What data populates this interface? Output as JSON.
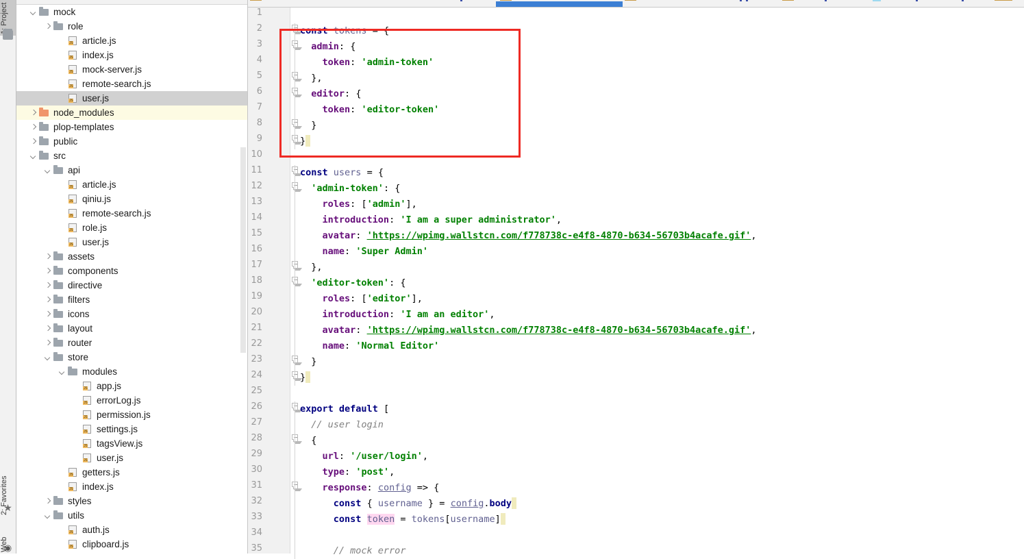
{
  "window": {
    "app": "IntelliJ IDEA / WebStorm project window"
  },
  "tool_strip": {
    "buttons": [
      {
        "label": "1: Project",
        "icon": "folder-icon",
        "active": true
      },
      {
        "label": "2: Favorites",
        "icon": "star-icon",
        "active": false
      },
      {
        "label": "Web",
        "icon": "globe-icon",
        "active": false
      }
    ]
  },
  "project_tree": {
    "items": [
      {
        "label": "mock",
        "indent": 2,
        "arrow": "open",
        "icon": "folder-icon",
        "state": "normal"
      },
      {
        "label": "role",
        "indent": 3,
        "arrow": "closed",
        "icon": "folder-icon",
        "state": "normal"
      },
      {
        "label": "article.js",
        "indent": 4,
        "arrow": "none",
        "icon": "js-file-icon",
        "state": "normal"
      },
      {
        "label": "index.js",
        "indent": 4,
        "arrow": "none",
        "icon": "js-file-icon",
        "state": "normal"
      },
      {
        "label": "mock-server.js",
        "indent": 4,
        "arrow": "none",
        "icon": "js-file-icon",
        "state": "normal"
      },
      {
        "label": "remote-search.js",
        "indent": 4,
        "arrow": "none",
        "icon": "js-file-icon",
        "state": "normal"
      },
      {
        "label": "user.js",
        "indent": 4,
        "arrow": "none",
        "icon": "js-file-icon",
        "state": "selected"
      },
      {
        "label": "node_modules",
        "indent": 2,
        "arrow": "closed",
        "icon": "folder-icon-orange",
        "state": "highlighted"
      },
      {
        "label": "plop-templates",
        "indent": 2,
        "arrow": "closed",
        "icon": "folder-icon",
        "state": "normal"
      },
      {
        "label": "public",
        "indent": 2,
        "arrow": "closed",
        "icon": "folder-icon",
        "state": "normal"
      },
      {
        "label": "src",
        "indent": 2,
        "arrow": "open",
        "icon": "folder-icon",
        "state": "normal"
      },
      {
        "label": "api",
        "indent": 3,
        "arrow": "open",
        "icon": "folder-icon",
        "state": "normal"
      },
      {
        "label": "article.js",
        "indent": 4,
        "arrow": "none",
        "icon": "js-file-icon",
        "state": "normal"
      },
      {
        "label": "qiniu.js",
        "indent": 4,
        "arrow": "none",
        "icon": "js-file-icon",
        "state": "normal"
      },
      {
        "label": "remote-search.js",
        "indent": 4,
        "arrow": "none",
        "icon": "js-file-icon",
        "state": "normal"
      },
      {
        "label": "role.js",
        "indent": 4,
        "arrow": "none",
        "icon": "js-file-icon",
        "state": "normal"
      },
      {
        "label": "user.js",
        "indent": 4,
        "arrow": "none",
        "icon": "js-file-icon",
        "state": "normal"
      },
      {
        "label": "assets",
        "indent": 3,
        "arrow": "closed",
        "icon": "folder-icon",
        "state": "normal"
      },
      {
        "label": "components",
        "indent": 3,
        "arrow": "closed",
        "icon": "folder-icon",
        "state": "normal"
      },
      {
        "label": "directive",
        "indent": 3,
        "arrow": "closed",
        "icon": "folder-icon",
        "state": "normal"
      },
      {
        "label": "filters",
        "indent": 3,
        "arrow": "closed",
        "icon": "folder-icon",
        "state": "normal"
      },
      {
        "label": "icons",
        "indent": 3,
        "arrow": "closed",
        "icon": "folder-icon",
        "state": "normal"
      },
      {
        "label": "layout",
        "indent": 3,
        "arrow": "closed",
        "icon": "folder-icon",
        "state": "normal"
      },
      {
        "label": "router",
        "indent": 3,
        "arrow": "closed",
        "icon": "folder-icon",
        "state": "normal"
      },
      {
        "label": "store",
        "indent": 3,
        "arrow": "open",
        "icon": "folder-icon",
        "state": "normal"
      },
      {
        "label": "modules",
        "indent": 4,
        "arrow": "open",
        "icon": "folder-icon",
        "state": "normal"
      },
      {
        "label": "app.js",
        "indent": 5,
        "arrow": "none",
        "icon": "js-file-icon",
        "state": "normal"
      },
      {
        "label": "errorLog.js",
        "indent": 5,
        "arrow": "none",
        "icon": "js-file-icon",
        "state": "normal"
      },
      {
        "label": "permission.js",
        "indent": 5,
        "arrow": "none",
        "icon": "js-file-icon",
        "state": "normal"
      },
      {
        "label": "settings.js",
        "indent": 5,
        "arrow": "none",
        "icon": "js-file-icon",
        "state": "normal"
      },
      {
        "label": "tagsView.js",
        "indent": 5,
        "arrow": "none",
        "icon": "js-file-icon",
        "state": "normal"
      },
      {
        "label": "user.js",
        "indent": 5,
        "arrow": "none",
        "icon": "js-file-icon",
        "state": "normal"
      },
      {
        "label": "getters.js",
        "indent": 4,
        "arrow": "none",
        "icon": "js-file-icon",
        "state": "normal"
      },
      {
        "label": "index.js",
        "indent": 4,
        "arrow": "none",
        "icon": "js-file-icon",
        "state": "normal"
      },
      {
        "label": "styles",
        "indent": 3,
        "arrow": "closed",
        "icon": "folder-icon",
        "state": "normal"
      },
      {
        "label": "utils",
        "indent": 3,
        "arrow": "open",
        "icon": "folder-icon",
        "state": "normal"
      },
      {
        "label": "auth.js",
        "indent": 4,
        "arrow": "none",
        "icon": "js-file-icon",
        "state": "normal"
      },
      {
        "label": "clipboard.js",
        "indent": 4,
        "arrow": "none",
        "icon": "js-file-icon",
        "state": "normal"
      }
    ]
  },
  "editor": {
    "first_visible_line": 1,
    "last_visible_line": 35,
    "line_numbers": [
      1,
      2,
      3,
      4,
      5,
      6,
      7,
      8,
      9,
      10,
      11,
      12,
      13,
      14,
      15,
      16,
      17,
      18,
      19,
      20,
      21,
      22,
      23,
      24,
      25,
      26,
      27,
      28,
      29,
      30,
      31,
      32,
      33,
      34,
      35
    ],
    "fold_lines": [
      2,
      3,
      5,
      6,
      8,
      9,
      11,
      12,
      17,
      18,
      23,
      24,
      26,
      28,
      31
    ],
    "annotation": {
      "type": "red-rectangle-highlight",
      "color": "#ee2a24",
      "covers_lines": "2-9",
      "content": "const tokens = { admin: { token: 'admin-token' }, editor: { token: 'editor-token' } }"
    },
    "lines": [
      {
        "n": 1,
        "text": ""
      },
      {
        "n": 2,
        "text": "const tokens = {"
      },
      {
        "n": 3,
        "text": "  admin: {"
      },
      {
        "n": 4,
        "text": "    token: 'admin-token'"
      },
      {
        "n": 5,
        "text": "  },"
      },
      {
        "n": 6,
        "text": "  editor: {"
      },
      {
        "n": 7,
        "text": "    token: 'editor-token'"
      },
      {
        "n": 8,
        "text": "  }"
      },
      {
        "n": 9,
        "text": "}"
      },
      {
        "n": 10,
        "text": ""
      },
      {
        "n": 11,
        "text": "const users = {"
      },
      {
        "n": 12,
        "text": "  'admin-token': {"
      },
      {
        "n": 13,
        "text": "    roles: ['admin'],"
      },
      {
        "n": 14,
        "text": "    introduction: 'I am a super administrator',"
      },
      {
        "n": 15,
        "text": "    avatar: 'https://wpimg.wallstcn.com/f778738c-e4f8-4870-b634-56703b4acafe.gif',"
      },
      {
        "n": 16,
        "text": "    name: 'Super Admin'"
      },
      {
        "n": 17,
        "text": "  },"
      },
      {
        "n": 18,
        "text": "  'editor-token': {"
      },
      {
        "n": 19,
        "text": "    roles: ['editor'],"
      },
      {
        "n": 20,
        "text": "    introduction: 'I am an editor',"
      },
      {
        "n": 21,
        "text": "    avatar: 'https://wpimg.wallstcn.com/f778738c-e4f8-4870-b634-56703b4acafe.gif',"
      },
      {
        "n": 22,
        "text": "    name: 'Normal Editor'"
      },
      {
        "n": 23,
        "text": "  }"
      },
      {
        "n": 24,
        "text": "}"
      },
      {
        "n": 25,
        "text": ""
      },
      {
        "n": 26,
        "text": "export default ["
      },
      {
        "n": 27,
        "text": "  // user login"
      },
      {
        "n": 28,
        "text": "  {"
      },
      {
        "n": 29,
        "text": "    url: '/user/login',"
      },
      {
        "n": 30,
        "text": "    type: 'post',"
      },
      {
        "n": 31,
        "text": "    response: config => {"
      },
      {
        "n": 32,
        "text": "      const { username } = config.body"
      },
      {
        "n": 33,
        "text": "      const token = tokens[username]"
      },
      {
        "n": 34,
        "text": ""
      },
      {
        "n": 35,
        "text": "      // mock error"
      }
    ]
  },
  "colors": {
    "keyword": "#000080",
    "string": "#008000",
    "property": "#660e7a",
    "comment": "#808080",
    "annotation_red": "#ee2a24",
    "selected_row": "#d1d1d1",
    "highlight_row": "#fdfbe3",
    "gutter_bg": "#f1f1f1",
    "line_number": "#999999",
    "js_badge": "#f0b95c",
    "folder": "#9da5ad",
    "folder_excluded": "#f0956a",
    "tab_active": "#3c7fd4",
    "token_occurrence_highlight": "#ffd7f0"
  }
}
